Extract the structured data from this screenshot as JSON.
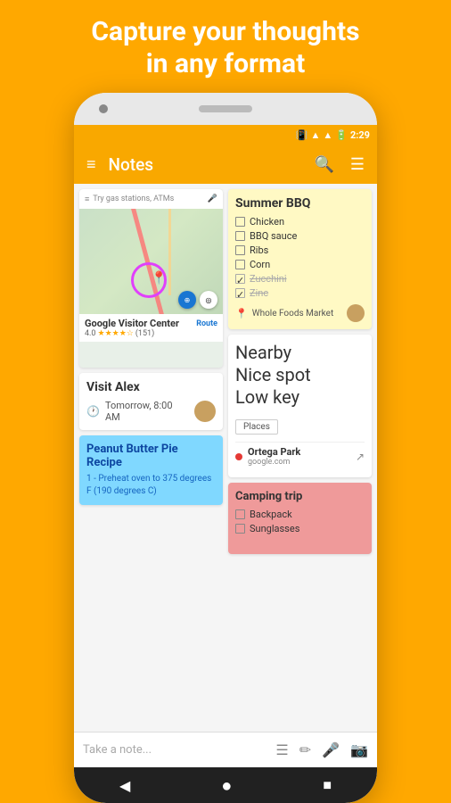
{
  "hero": {
    "line1": "Capture your thoughts",
    "line2": "in any format"
  },
  "status_bar": {
    "time": "2:29",
    "icons": [
      "vibrate",
      "wifi",
      "signal",
      "battery"
    ]
  },
  "toolbar": {
    "title": "Notes",
    "menu_icon": "≡",
    "search_icon": "🔍",
    "more_icon": "☰"
  },
  "notes": {
    "map_note": {
      "search_placeholder": "Try gas stations, ATMs",
      "place_name": "Google Visitor Center",
      "rating": "4.0",
      "review_count": "(151)",
      "route_label": "Route"
    },
    "visit_alex": {
      "title": "Visit Alex",
      "time": "Tomorrow, 8:00 AM"
    },
    "recipe": {
      "title": "Peanut Butter Pie Recipe",
      "text": "1 - Preheat oven to 375 degrees F (190 degrees C)"
    },
    "bbq": {
      "title": "Summer BBQ",
      "items": [
        {
          "text": "Chicken",
          "checked": false,
          "strikethrough": false
        },
        {
          "text": "BBQ sauce",
          "checked": false,
          "strikethrough": false
        },
        {
          "text": "Ribs",
          "checked": false,
          "strikethrough": false
        },
        {
          "text": "Corn",
          "checked": false,
          "strikethrough": false
        },
        {
          "text": "Zucchini",
          "checked": true,
          "strikethrough": true
        },
        {
          "text": "Zinc",
          "checked": true,
          "strikethrough": true
        }
      ],
      "location": "Whole Foods Market"
    },
    "nearby": {
      "lines": [
        "Nearby",
        "Nice spot",
        "Low key"
      ],
      "button": "Places",
      "ortega_name": "Ortega Park",
      "ortega_url": "google.com"
    },
    "camping": {
      "title": "Camping trip",
      "items": [
        {
          "text": "Backpack",
          "checked": false
        },
        {
          "text": "Sunglasses",
          "checked": false
        }
      ]
    }
  },
  "input_bar": {
    "placeholder": "Take a note...",
    "icons": [
      "list",
      "pencil",
      "mic",
      "camera"
    ]
  },
  "nav": {
    "back": "◀",
    "home": "●",
    "square": "■"
  }
}
